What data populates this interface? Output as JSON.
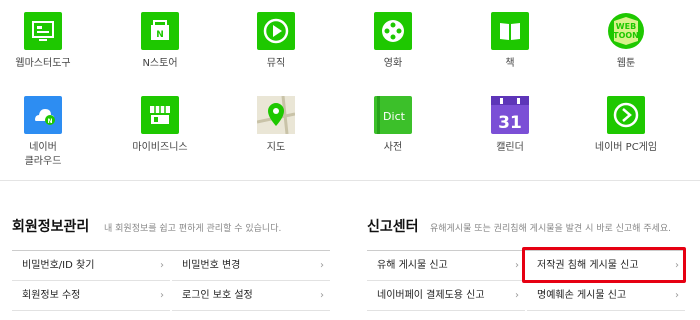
{
  "apps": [
    {
      "id": "webmaster",
      "label": "웹마스터도구",
      "icon": "webmaster-tool-icon"
    },
    {
      "id": "nstore",
      "label": "N스토어",
      "icon": "nstore-bag-icon"
    },
    {
      "id": "music",
      "label": "뮤직",
      "icon": "music-play-icon"
    },
    {
      "id": "movie",
      "label": "영화",
      "icon": "film-reel-icon"
    },
    {
      "id": "book",
      "label": "책",
      "icon": "book-icon"
    },
    {
      "id": "webtoon",
      "label": "웹툰",
      "icon": "webtoon-icon",
      "logo": "WEB TOON"
    },
    {
      "id": "mybox",
      "label": "네이버\n클라우드",
      "icon": "cloud-icon"
    },
    {
      "id": "mybiz",
      "label": "마이비즈니스",
      "icon": "store-front-icon"
    },
    {
      "id": "map",
      "label": "지도",
      "icon": "map-pin-icon"
    },
    {
      "id": "dict",
      "label": "사전",
      "icon": "dictionary-icon",
      "logo": "Dict"
    },
    {
      "id": "calendar",
      "label": "캘린더",
      "icon": "calendar-icon",
      "logo": "31"
    },
    {
      "id": "pcgame",
      "label": "네이버 PC게임",
      "icon": "pc-game-icon"
    }
  ],
  "member": {
    "title": "회원정보관리",
    "desc": "내 회원정보를 쉽고 편하게 관리할 수 있습니다.",
    "items": [
      "비밀번호/ID 찾기",
      "비밀번호 변경",
      "회원정보 수정",
      "로그인 보호 설정"
    ]
  },
  "report": {
    "title": "신고센터",
    "desc": "유해게시물 또는 권리침해 게시물을 발견 시 바로 신고해 주세요.",
    "items": [
      "유해 게시물 신고",
      "저작권 침해 게시물 신고",
      "네이버페이 결제도용 신고",
      "명예훼손 게시물 신고"
    ]
  },
  "arrow": "›",
  "colors": {
    "accent": "#1ec800",
    "highlight": "#e60012",
    "calendar": "#7b4fd6",
    "cloud": "#1e90ff"
  }
}
